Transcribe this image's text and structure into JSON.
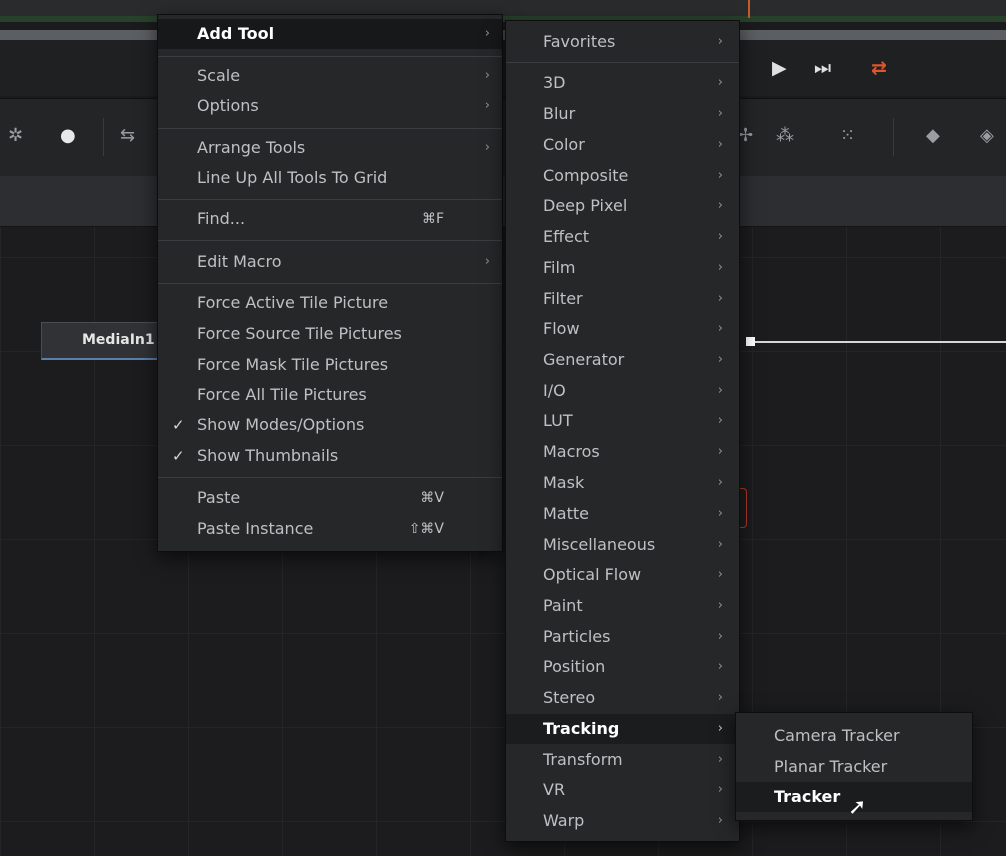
{
  "transport": {
    "play": "▶",
    "skip_end": "⏭",
    "loop": "⇄",
    "loop_color": "#e0552c"
  },
  "toolbar": {
    "icons": [
      "sparkle-icon",
      "drop-icon",
      "link-icon",
      "particle-icon",
      "particle-emitter-icon",
      "particle-render-icon",
      "3d-shape-icon",
      "3d-merge-icon"
    ]
  },
  "node": {
    "label": "MediaIn1"
  },
  "context_menu": {
    "items": [
      {
        "label": "Add Tool",
        "arrow": "›"
      },
      {
        "label": "Scale",
        "arrow": "›"
      },
      {
        "label": "Options",
        "arrow": "›"
      },
      {
        "label": "Arrange Tools",
        "arrow": "›"
      },
      {
        "label": "Line Up All Tools To Grid"
      },
      {
        "label": "Find...",
        "shortcut": "⌘F"
      },
      {
        "label": "Edit Macro",
        "arrow": "›"
      },
      {
        "label": "Force Active Tile Picture"
      },
      {
        "label": "Force Source Tile Pictures"
      },
      {
        "label": "Force Mask Tile Pictures"
      },
      {
        "label": "Force All Tile Pictures"
      },
      {
        "label": "Show Modes/Options",
        "check": "✓"
      },
      {
        "label": "Show Thumbnails",
        "check": "✓"
      },
      {
        "label": "Paste",
        "shortcut": "⌘V"
      },
      {
        "label": "Paste Instance",
        "shortcut": "⇧⌘V"
      }
    ]
  },
  "tools_menu": {
    "items": [
      "Favorites",
      "3D",
      "Blur",
      "Color",
      "Composite",
      "Deep Pixel",
      "Effect",
      "Film",
      "Filter",
      "Flow",
      "Generator",
      "I/O",
      "LUT",
      "Macros",
      "Mask",
      "Matte",
      "Miscellaneous",
      "Optical Flow",
      "Paint",
      "Particles",
      "Position",
      "Stereo",
      "Tracking",
      "Transform",
      "VR",
      "Warp"
    ],
    "arrow": "›",
    "highlighted": "Tracking"
  },
  "tracking_menu": {
    "items": [
      "Camera Tracker",
      "Planar Tracker",
      "Tracker"
    ],
    "highlighted": "Tracker"
  },
  "colors": {
    "menu_bg": "#262729",
    "highlight_bg": "#17181a",
    "accent_loop": "#e0552c",
    "node_underline": "#5a7fa8"
  }
}
